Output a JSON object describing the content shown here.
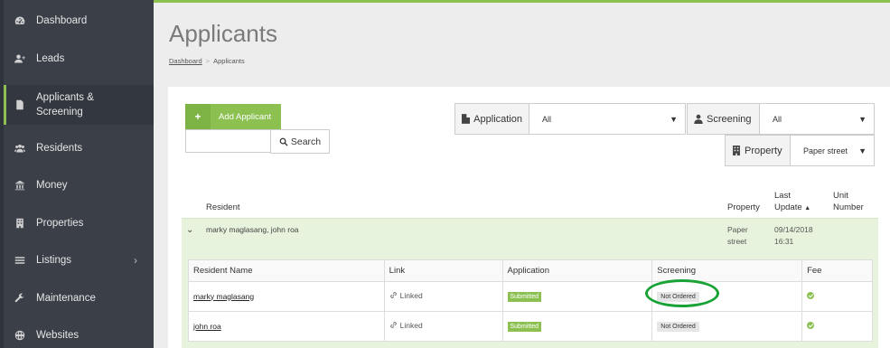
{
  "sidebar": {
    "items": [
      {
        "label": "Dashboard",
        "icon": "dashboard-icon"
      },
      {
        "label": "Leads",
        "icon": "user-plus-icon"
      },
      {
        "label": "Applicants & Screening",
        "icon": "file-icon"
      },
      {
        "label": "Residents",
        "icon": "users-icon"
      },
      {
        "label": "Money",
        "icon": "bank-icon"
      },
      {
        "label": "Properties",
        "icon": "building-icon"
      },
      {
        "label": "Listings",
        "icon": "list-icon"
      },
      {
        "label": "Maintenance",
        "icon": "wrench-icon"
      },
      {
        "label": "Websites",
        "icon": "globe-icon"
      }
    ],
    "active_index": 2
  },
  "page": {
    "title": "Applicants",
    "breadcrumb_home": "Dashboard",
    "breadcrumb_current": "Applicants"
  },
  "toolbar": {
    "add_label": "Add Applicant",
    "search_value": "",
    "search_label": "Search"
  },
  "filters": {
    "application": {
      "label": "Application",
      "value": "All"
    },
    "screening": {
      "label": "Screening",
      "value": "All"
    },
    "property": {
      "label": "Property",
      "value": "Paper street"
    }
  },
  "table": {
    "headers": {
      "resident": "Resident",
      "property": "Property",
      "last_update_1": "Last",
      "last_update_2": "Update",
      "unit_1": "Unit",
      "unit_2": "Number"
    },
    "group": {
      "residents": "marky maglasang, john roa",
      "property_1": "Paper",
      "property_2": "street",
      "date": "09/14/2018",
      "time": "16:31"
    }
  },
  "sub_table": {
    "headers": [
      "Resident Name",
      "Link",
      "Application",
      "Screening",
      "Fee"
    ],
    "rows": [
      {
        "name": "marky maglasang",
        "link": "Linked",
        "application": "Submitted",
        "screening": "Not Ordered"
      },
      {
        "name": "john roa",
        "link": "Linked",
        "application": "Submitted",
        "screening": "Not Ordered"
      }
    ]
  },
  "colors": {
    "accent": "#8cc152",
    "sidebar_bg": "#3a3f48",
    "annotation": "#19a337"
  }
}
